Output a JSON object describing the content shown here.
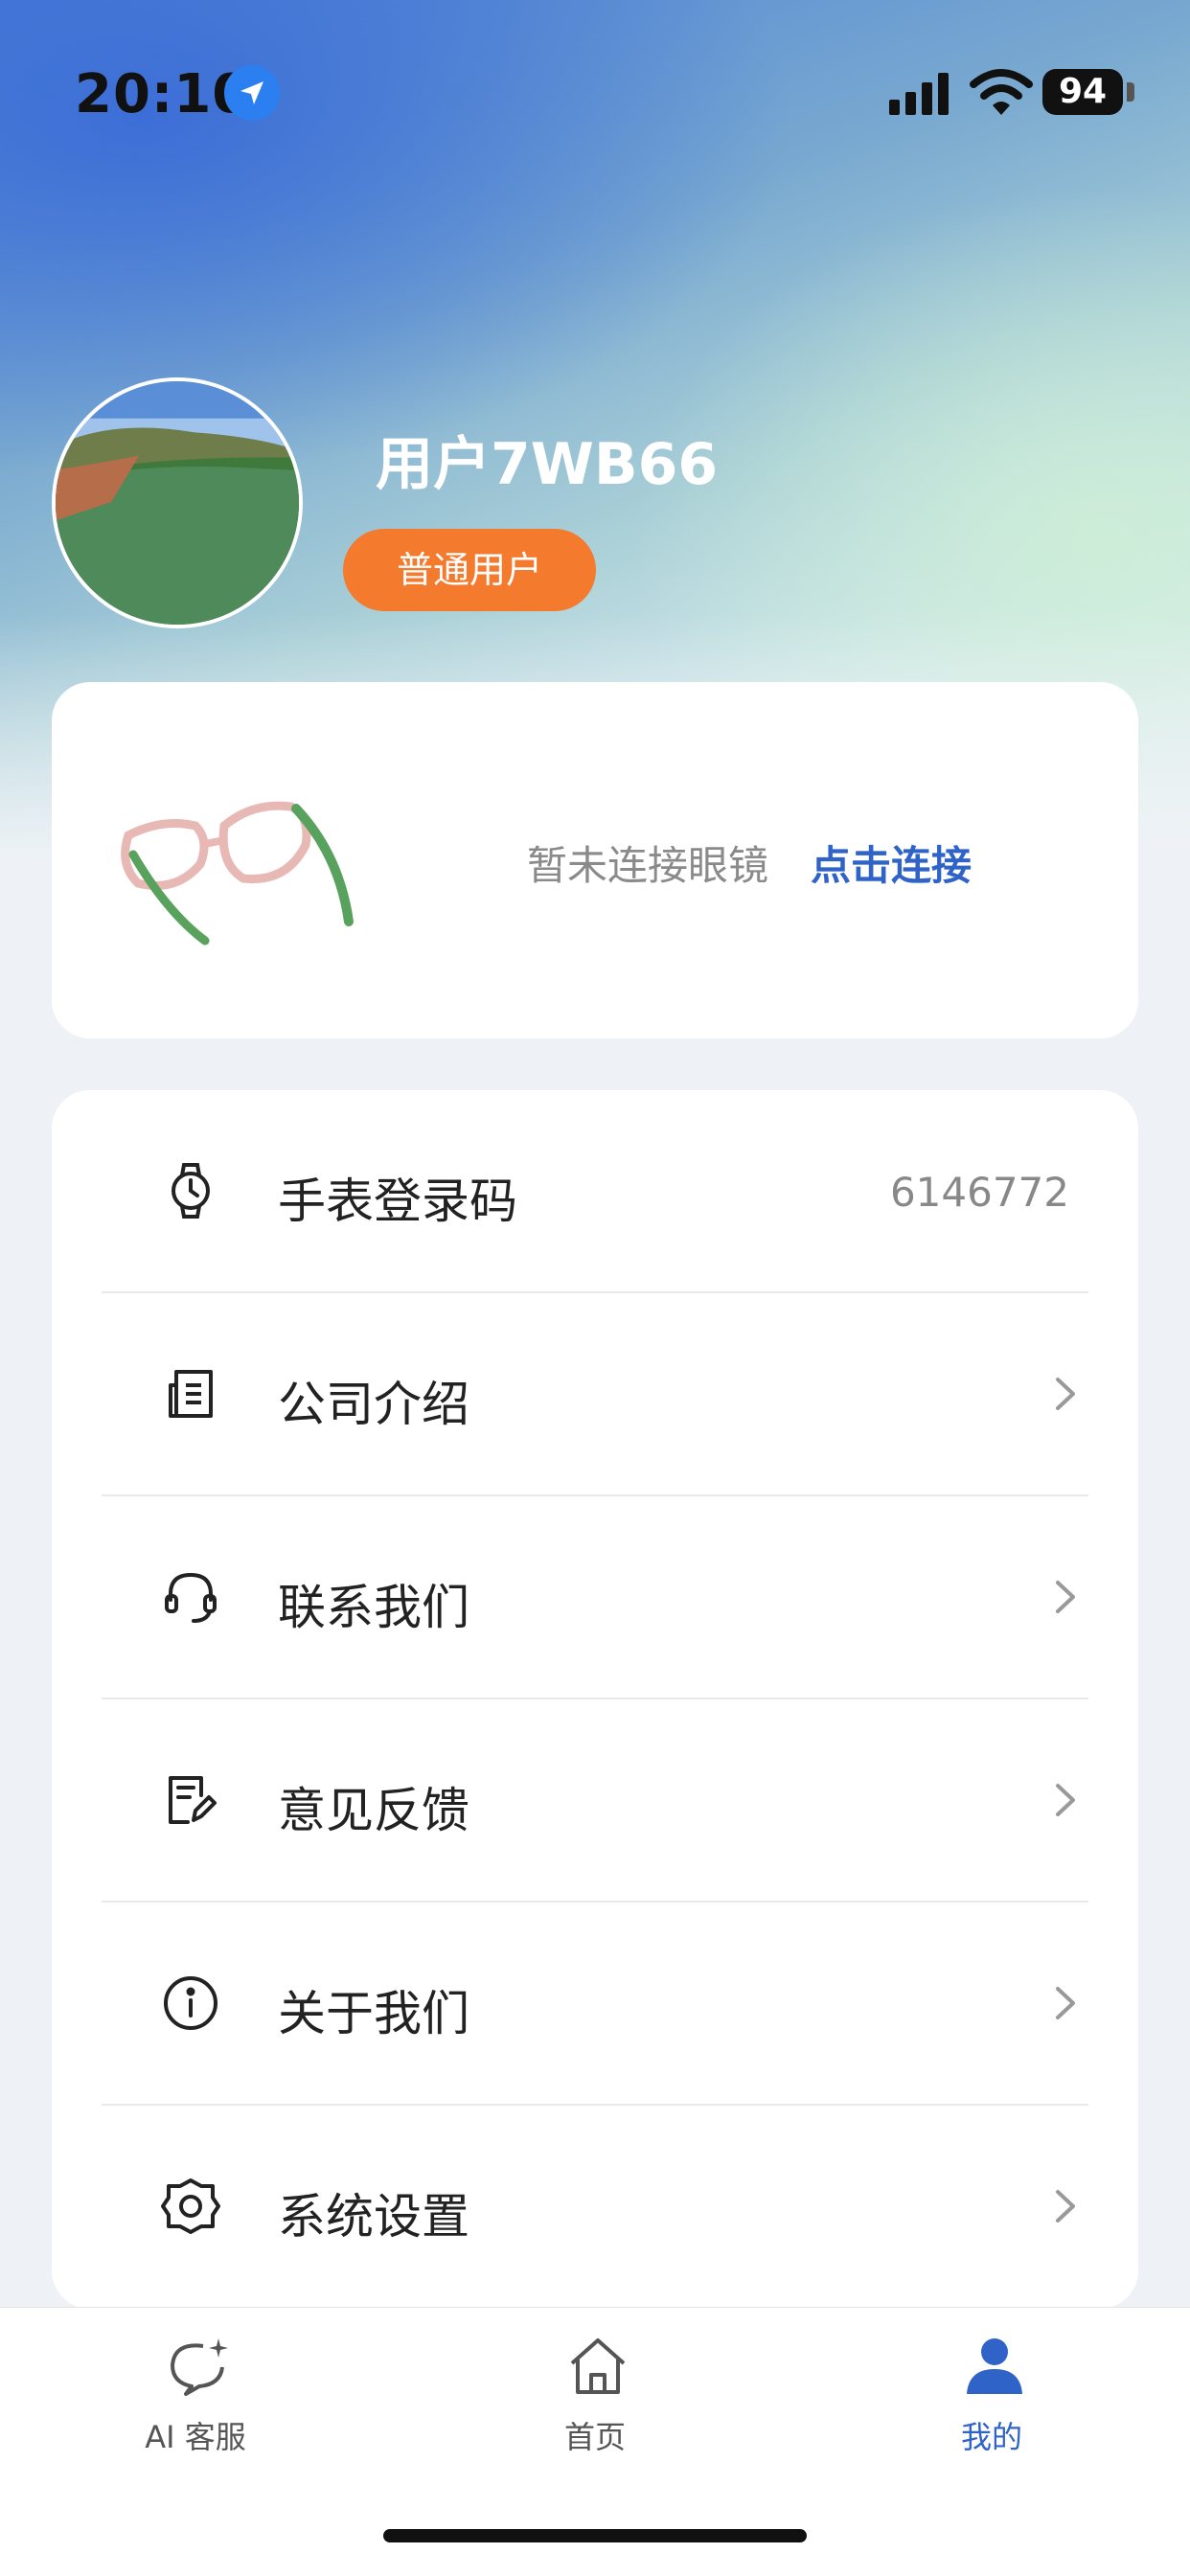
{
  "status_bar": {
    "time": "20:10",
    "battery": "94",
    "icons": [
      "location-arrow-icon",
      "cellular-signal-icon",
      "wifi-icon",
      "battery-icon"
    ]
  },
  "profile": {
    "username": "用户7WB66",
    "badge": "普通用户",
    "badge_color": "#f47a2e"
  },
  "device": {
    "status_text": "暂未连接眼镜",
    "connect_label": "点击连接",
    "link_color": "#2f63c8"
  },
  "menu": {
    "items": [
      {
        "label": "手表登录码",
        "value": "6146772",
        "icon": "watch-icon"
      },
      {
        "label": "公司介绍",
        "icon": "company-doc-icon"
      },
      {
        "label": "联系我们",
        "icon": "headset-icon"
      },
      {
        "label": "意见反馈",
        "icon": "feedback-edit-icon"
      },
      {
        "label": "关于我们",
        "icon": "info-icon"
      },
      {
        "label": "系统设置",
        "icon": "gear-icon"
      }
    ]
  },
  "tabbar": {
    "tabs": [
      {
        "label": "AI 客服",
        "icon": "ai-chat-icon",
        "active": false
      },
      {
        "label": "首页",
        "icon": "home-icon",
        "active": false
      },
      {
        "label": "我的",
        "icon": "person-icon",
        "active": true
      }
    ],
    "active_color": "#2f63c8"
  }
}
